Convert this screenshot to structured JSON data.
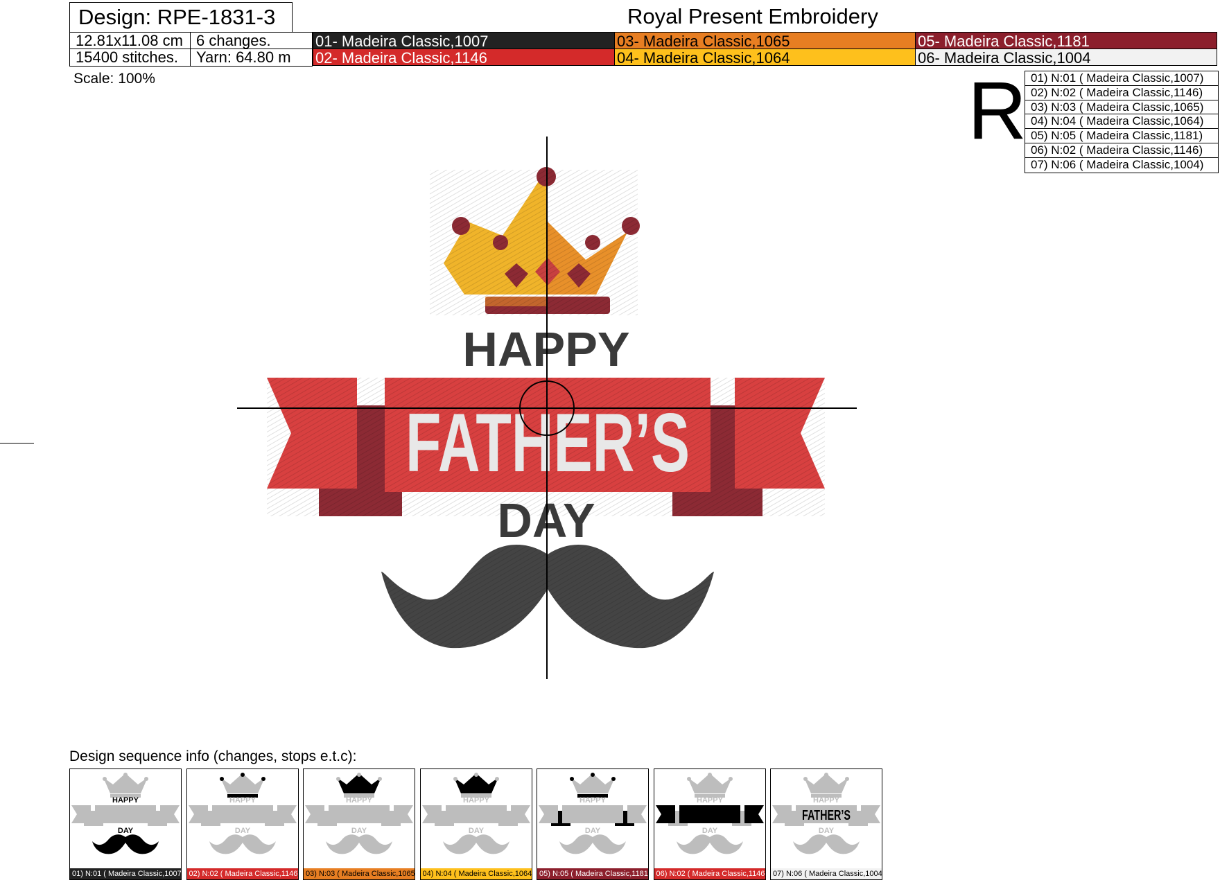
{
  "header": {
    "design_title": "Design: RPE-1831-3",
    "company": "Royal Present Embroidery"
  },
  "info": {
    "size": "12.81x11.08 cm",
    "changes": "6 changes.",
    "stitches": "15400 stitches.",
    "yarn": "Yarn: 64.80 m"
  },
  "threads": [
    {
      "label": "01- Madeira Classic,1007",
      "color": "#222222",
      "text_color": "#ffffff"
    },
    {
      "label": "02- Madeira Classic,1146",
      "color": "#d42a2a",
      "text_color": "#ffffff"
    },
    {
      "label": "03- Madeira Classic,1065",
      "color": "#e77e22",
      "text_color": "#000000"
    },
    {
      "label": "04- Madeira Classic,1064",
      "color": "#fec01c",
      "text_color": "#000000"
    },
    {
      "label": "05- Madeira Classic,1181",
      "color": "#8c1f2c",
      "text_color": "#ffffff"
    },
    {
      "label": "06- Madeira Classic,1004",
      "color": "#f2f2f2",
      "text_color": "#000000"
    }
  ],
  "scale": "Scale: 100%",
  "marker_letter": "R",
  "sequence": [
    {
      "label": "01) N:01 ( Madeira Classic,1007)",
      "color": "#222222",
      "text_color": "#ffffff"
    },
    {
      "label": "02) N:02 ( Madeira Classic,1146)",
      "color": "#d42a2a",
      "text_color": "#ffffff"
    },
    {
      "label": "03) N:03 ( Madeira Classic,1065)",
      "color": "#e77e22",
      "text_color": "#000000"
    },
    {
      "label": "04) N:04 ( Madeira Classic,1064)",
      "color": "#fec01c",
      "text_color": "#000000"
    },
    {
      "label": "05) N:05 ( Madeira Classic,1181)",
      "color": "#8c1f2c",
      "text_color": "#ffffff"
    },
    {
      "label": "06) N:02 ( Madeira Classic,1146)",
      "color": "#d42a2a",
      "text_color": "#ffffff"
    },
    {
      "label": "07) N:06 ( Madeira Classic,1004)",
      "color": "#f2f2f2",
      "text_color": "#000000"
    }
  ],
  "design_text": {
    "happy": "HAPPY",
    "fathers": "FATHER’S",
    "day": "DAY"
  },
  "sequence_title": "Design sequence info (changes, stops e.t.c):",
  "colors": {
    "crown_gold": "#f0b42a",
    "crown_orange": "#e8902a",
    "crown_maroon": "#8c2a34",
    "ribbon_red": "#d84040",
    "ribbon_dark": "#8c2a34",
    "text_gray": "#3a3a3a",
    "text_white": "#e8e8e8",
    "mustache": "#444444",
    "thumb_gray": "#bdbdbd"
  }
}
